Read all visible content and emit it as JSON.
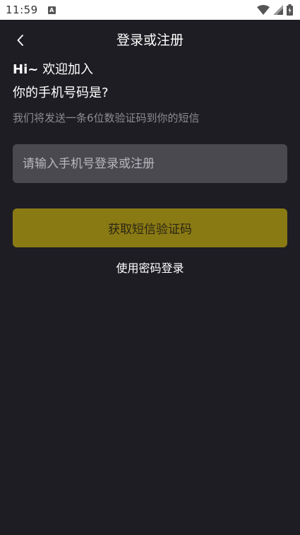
{
  "status_bar": {
    "time": "11:59",
    "notification_badge": "A",
    "icons": [
      "wifi-icon",
      "signal-icon",
      "battery-icon"
    ]
  },
  "nav": {
    "back_icon": "chevron-left-icon",
    "title": "登录或注册"
  },
  "greeting": {
    "hi": "Hi~",
    "welcome": "欢迎加入",
    "question": "你的手机号码是?",
    "hint": "我们将发送一条6位数验证码到你的短信"
  },
  "form": {
    "phone_placeholder": "请输入手机号登录或注册",
    "phone_value": "",
    "sms_button_label": "获取短信验证码",
    "password_login_label": "使用密码登录"
  },
  "colors": {
    "background": "#1e1d23",
    "input_bg": "#4a4950",
    "accent_button": "#8a7a14",
    "hint_text": "#8d8c93"
  }
}
